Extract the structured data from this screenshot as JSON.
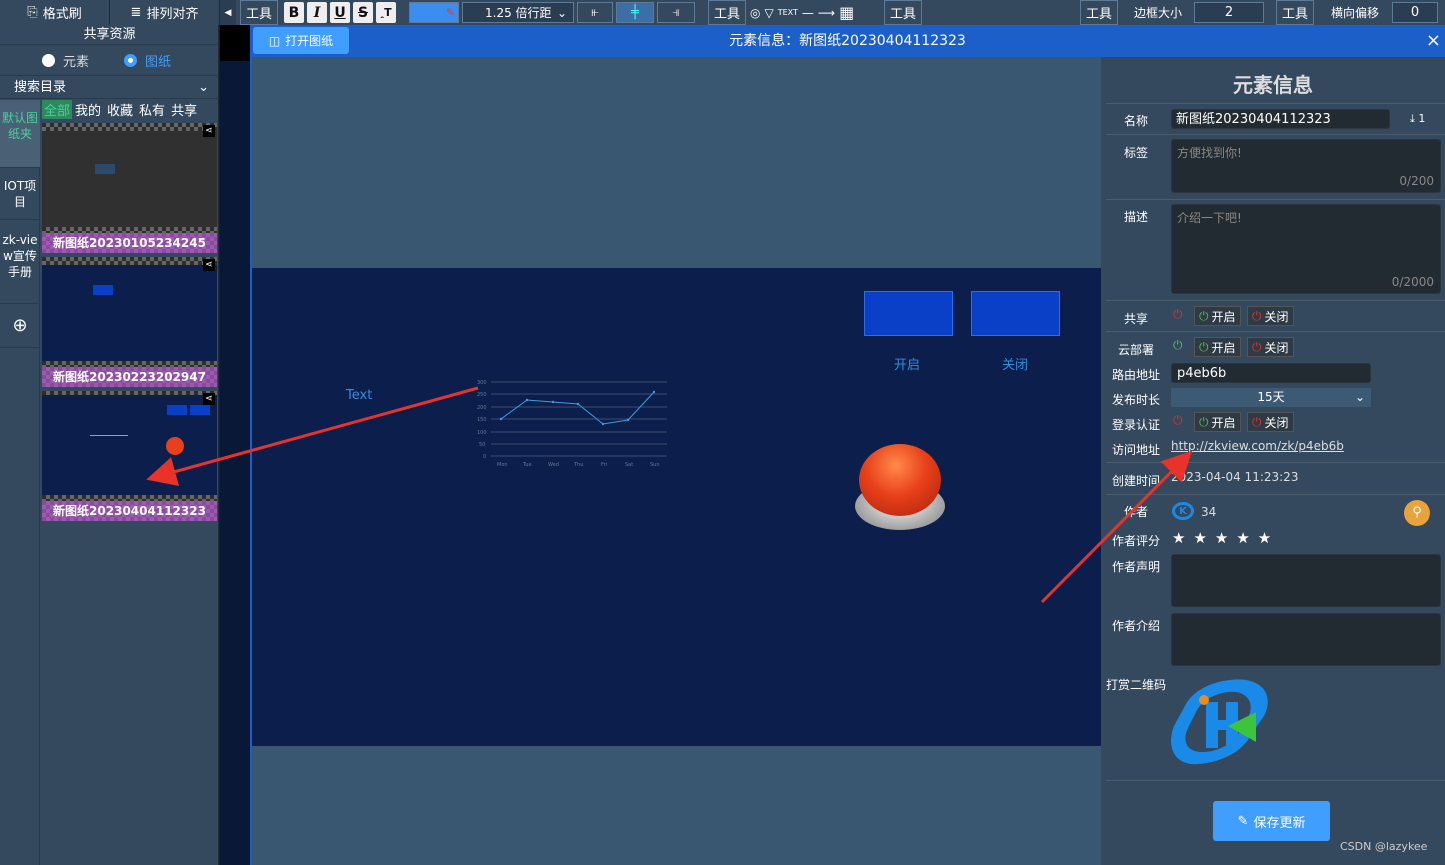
{
  "toolbar": {
    "format_brush": "格式刷",
    "arrange_align": "排列对齐",
    "tool_label": "工具",
    "bold": "B",
    "italic": "I",
    "underline": "U",
    "strike": "S",
    "line_spacing": "1.25 倍行距",
    "shapes_text": "TEXT",
    "border_size_label": "边框大小",
    "border_size_value": "2",
    "h_offset_label": "横向偏移",
    "h_offset_value": "0"
  },
  "left_panel": {
    "title": "共享资源",
    "radio_element": "元素",
    "radio_drawing": "图纸",
    "search_dir": "搜索目录",
    "categories": [
      "默认图纸夹",
      "IOT项目",
      "zk-view宣传手册"
    ],
    "filter_tabs": [
      "全部",
      "我的",
      "收藏",
      "私有",
      "共享"
    ],
    "thumbs": [
      "新图纸20230105234245",
      "新图纸20230223202947",
      "新图纸20230404112323"
    ]
  },
  "modal": {
    "open_button": "打开图纸",
    "title": "元素信息：新图纸20230404112323",
    "close": "×"
  },
  "canvas": {
    "text_widget": "Text",
    "btn_on_label": "开启",
    "btn_off_label": "关闭",
    "chart_days": [
      "Mon",
      "Tue",
      "Wed",
      "Thu",
      "Fri",
      "Sat",
      "Sun"
    ],
    "chart_ticks": [
      "300",
      "250",
      "200",
      "150",
      "100",
      "50",
      "0"
    ]
  },
  "info": {
    "heading": "元素信息",
    "name_label": "名称",
    "name_value": "新图纸20230404112323",
    "download_count": "1",
    "tag_label": "标签",
    "tag_placeholder": "方便找到你!",
    "tag_count": "0/200",
    "desc_label": "描述",
    "desc_placeholder": "介绍一下吧!",
    "desc_count": "0/2000",
    "share_label": "共享",
    "cloud_label": "云部署",
    "on": "开启",
    "off": "关闭",
    "route_label": "路由地址",
    "route_value": "p4eb6b",
    "publish_label": "发布时长",
    "publish_value": "15天",
    "auth_label": "登录认证",
    "url_label": "访问地址",
    "url_value": "http://zkview.com/zk/p4eb6b",
    "created_label": "创建时间",
    "created_value": "2023-04-04 11:23:23",
    "author_label": "作者",
    "author_value": "34",
    "rating_label": "作者评分",
    "statement_label": "作者声明",
    "intro_label": "作者介绍",
    "qr_label": "打赏二维码",
    "save_button": "保存更新",
    "watermark": "CSDN @lazykee"
  },
  "colors": {
    "accent": "#1d5fc8",
    "canvas_bg": "#0c1e4c",
    "panel_bg": "#34495e",
    "save_btn": "#409eff",
    "arrow": "#e8322a"
  }
}
